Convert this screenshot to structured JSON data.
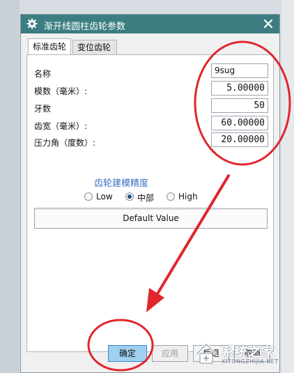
{
  "dialog": {
    "title": "渐开线圆柱齿轮参数",
    "tabs": [
      {
        "label": "标准齿轮",
        "active": true
      },
      {
        "label": "变位齿轮",
        "active": false
      }
    ],
    "fields": [
      {
        "label": "名称",
        "value": "9sug"
      },
      {
        "label": "模数（毫米）:",
        "value": "5.00000"
      },
      {
        "label": "牙数",
        "value": "50"
      },
      {
        "label": "齿宽（毫米）:",
        "value": "60.00000"
      },
      {
        "label": "压力角（度数）:",
        "value": "20.00000"
      }
    ],
    "precision": {
      "title": "齿轮建模精度",
      "options": [
        {
          "label": "Low",
          "selected": false
        },
        {
          "label": "中部",
          "selected": true
        },
        {
          "label": "High",
          "selected": false
        }
      ]
    },
    "default_button": "Default Value",
    "buttons": {
      "ok": "确定",
      "apply": "应用",
      "third": "后退",
      "cancel": "取消"
    }
  },
  "annotation_color": "#e0262b",
  "watermark": {
    "title": "系统之家",
    "sub": "XITONGZHIJIA.NET"
  }
}
